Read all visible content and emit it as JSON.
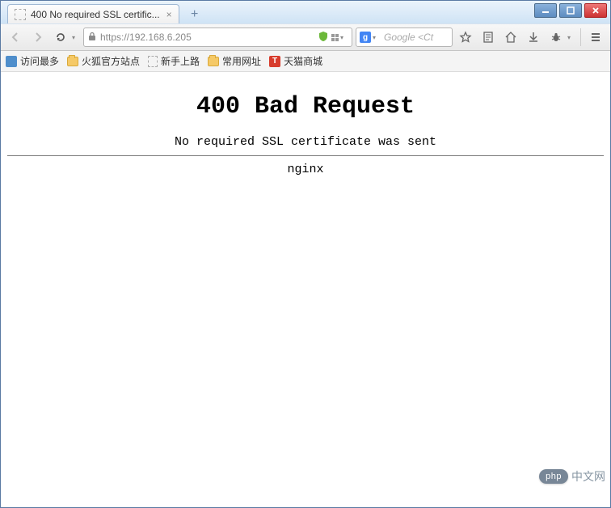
{
  "window": {
    "tab_title": "400 No required SSL certific...",
    "minimize_glyph": "—",
    "maximize_glyph": "☐",
    "close_glyph": "✕",
    "newtab_glyph": "+"
  },
  "nav": {
    "url_text": "https://192.168.6.205",
    "reload_caret": "▾",
    "url_caret": "▾"
  },
  "search": {
    "provider_letter": "g",
    "placeholder": "Google <Ct",
    "caret": "▾"
  },
  "toolbar_icons": {
    "back": "back-icon",
    "forward": "forward-icon",
    "reload": "reload-icon",
    "shield": "shield-icon",
    "star": "star-icon",
    "reader": "reader-icon",
    "home": "home-icon",
    "download": "download-icon",
    "bug": "bug-icon",
    "menu": "menu-icon"
  },
  "bookmarks": [
    {
      "icon": "blue",
      "label": "访问最多"
    },
    {
      "icon": "folder",
      "label": "火狐官方站点"
    },
    {
      "icon": "page",
      "label": "新手上路"
    },
    {
      "icon": "folder",
      "label": "常用网址"
    },
    {
      "icon": "tmall",
      "label": "天猫商城"
    }
  ],
  "error": {
    "title": "400 Bad Request",
    "subtitle": "No required SSL certificate was sent",
    "server": "nginx"
  },
  "watermark": {
    "badge": "php",
    "text": "中文网"
  }
}
